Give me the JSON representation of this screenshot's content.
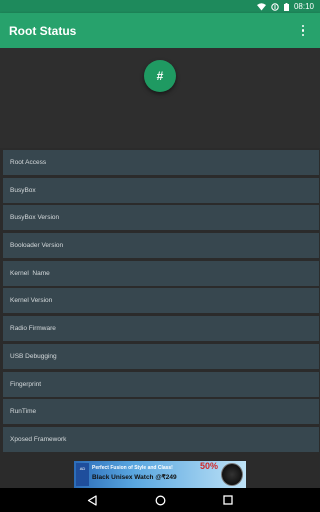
{
  "status_bar": {
    "time": "08:10"
  },
  "app_bar": {
    "title": "Root Status"
  },
  "fab": {
    "label": "#"
  },
  "items": [
    {
      "label": "Root Access"
    },
    {
      "label": "BusyBox"
    },
    {
      "label": "BusyBox Version"
    },
    {
      "label": "Booloader Version"
    },
    {
      "label": "Kernel  Name"
    },
    {
      "label": "Kernel Version"
    },
    {
      "label": "Radio Firmware"
    },
    {
      "label": "USB Debugging"
    },
    {
      "label": "Fingerprint"
    },
    {
      "label": "RunTime"
    },
    {
      "label": "Xposed Framework"
    }
  ],
  "ad": {
    "line1": "Perfect Fusion of Style and Class!",
    "line2": "Black Unisex Watch @₹249",
    "sale": "50%",
    "logo": "AD"
  },
  "colors": {
    "status_bar": "#1e8a5c",
    "app_bar": "#27a26c",
    "fab": "#1f9a62",
    "list_item": "#37474f",
    "background": "#2b2b2b"
  },
  "icons": [
    "wifi-icon",
    "data-saver-icon",
    "battery-icon",
    "overflow-menu-icon",
    "back-icon",
    "home-icon",
    "recents-icon"
  ]
}
